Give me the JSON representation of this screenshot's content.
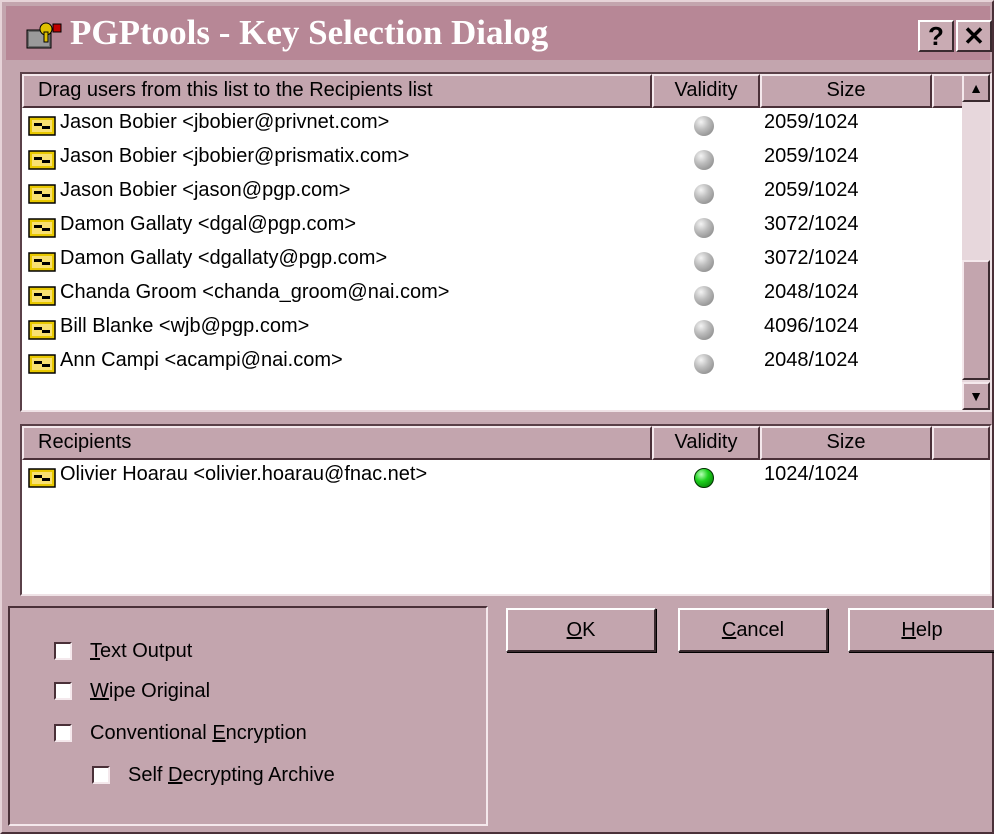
{
  "window": {
    "title": "PGPtools - Key Selection Dialog",
    "help_button": "?",
    "close_button": "✕"
  },
  "source_list": {
    "columns": [
      "Drag users from this list to the Recipients list",
      "Validity",
      "Size",
      ""
    ],
    "rows": [
      {
        "user": "Jason Bobier <jbobier@privnet.com>",
        "validity": "grey",
        "size": "2059/1024"
      },
      {
        "user": "Jason Bobier <jbobier@prismatix.com>",
        "validity": "grey",
        "size": "2059/1024"
      },
      {
        "user": "Jason Bobier <jason@pgp.com>",
        "validity": "grey",
        "size": "2059/1024"
      },
      {
        "user": "Damon Gallaty <dgal@pgp.com>",
        "validity": "grey",
        "size": "3072/1024"
      },
      {
        "user": "Damon Gallaty <dgallaty@pgp.com>",
        "validity": "grey",
        "size": "3072/1024"
      },
      {
        "user": "Chanda Groom <chanda_groom@nai.com>",
        "validity": "grey",
        "size": "2048/1024"
      },
      {
        "user": "Bill Blanke <wjb@pgp.com>",
        "validity": "grey",
        "size": "4096/1024"
      },
      {
        "user": "Ann Campi <acampi@nai.com>",
        "validity": "grey",
        "size": "2048/1024"
      }
    ],
    "scroll_up": "▲",
    "scroll_down": "▼"
  },
  "recipients_list": {
    "columns": [
      "Recipients",
      "Validity",
      "Size",
      ""
    ],
    "rows": [
      {
        "user": "Olivier Hoarau <olivier.hoarau@fnac.net>",
        "validity": "green",
        "size": "1024/1024"
      }
    ]
  },
  "options": {
    "text_output": {
      "pre": "",
      "key": "T",
      "post": "ext Output",
      "checked": false
    },
    "wipe_original": {
      "pre": "",
      "key": "W",
      "post": "ipe Original",
      "checked": false
    },
    "conventional_encryption": {
      "pre": "Conventional ",
      "key": "E",
      "post": "ncryption",
      "checked": false
    },
    "self_decrypting_archive": {
      "pre": "Self ",
      "key": "D",
      "post": "ecrypting Archive",
      "checked": false
    }
  },
  "buttons": {
    "ok": {
      "pre": "",
      "key": "O",
      "post": "K"
    },
    "cancel": {
      "pre": "",
      "key": "C",
      "post": "ancel"
    },
    "help": {
      "pre": "",
      "key": "H",
      "post": "elp"
    }
  },
  "colors": {
    "dialog_face": "#c3a5ae",
    "titlebar": "#b78796",
    "valid_green": "#1ed11e",
    "invalid_grey": "#bdbdbd"
  }
}
